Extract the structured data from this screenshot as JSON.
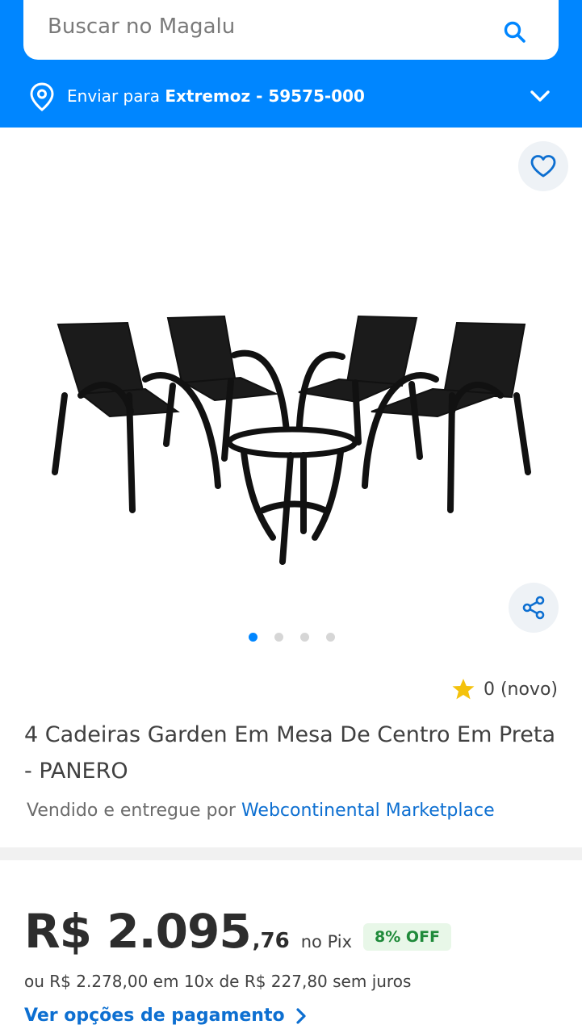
{
  "search": {
    "placeholder": "Buscar no Magalu"
  },
  "shipping": {
    "prefix": "Enviar para",
    "location": "Extremoz - 59575-000"
  },
  "rating": {
    "text": "0 (novo)"
  },
  "product": {
    "title": "4 Cadeiras Garden Em Mesa De Centro Em Preta - PANERO",
    "seller_prefix": "Vendido e entregue por",
    "seller_name": "Webcontinental Marketplace"
  },
  "carousel": {
    "total": 4,
    "active_index": 0
  },
  "price": {
    "main": "R$ 2.095",
    "cents": ",76",
    "method": "no Pix",
    "discount_badge": "8% OFF",
    "installments": "ou R$ 2.278,00 em 10x de R$ 227,80 sem juros",
    "payment_link": "Ver opções de pagamento"
  },
  "colors": {
    "brand_blue": "#0086ff",
    "link_blue": "#0d6fd1",
    "star_yellow": "#f4c20d",
    "badge_green": "#1f8a3a"
  },
  "icons": [
    "search-icon",
    "location-pin-icon",
    "chevron-down-icon",
    "heart-icon",
    "share-icon",
    "star-icon",
    "chevron-right-icon"
  ]
}
